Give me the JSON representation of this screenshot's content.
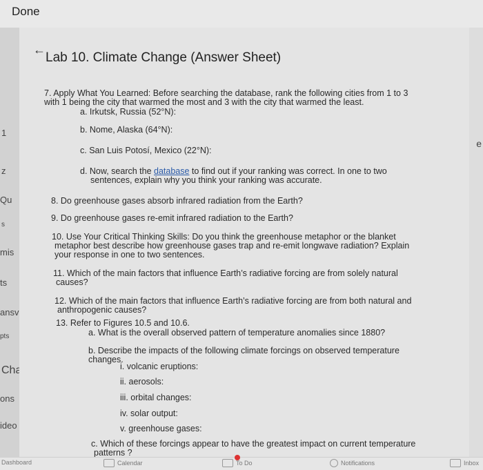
{
  "topbar": {
    "done_label": "Done"
  },
  "left_fragments": [
    "1",
    "z",
    "Qu",
    "s",
    "mis",
    "ts",
    "ansv",
    "pts",
    "Cha",
    "ons",
    "ideo",
    "Dashboard"
  ],
  "right_fragment": "e",
  "header": {
    "back_icon": "arrow-left-icon",
    "title": "Lab 10. Climate Change (Answer Sheet)"
  },
  "questions": {
    "q7": {
      "text_line1": "7. Apply What You Learned: Before searching the database, rank the following cities from 1 to 3",
      "text_line2": "with 1 being the city that warmed the most and 3 with the city that warmed the least.",
      "a": "a. Irkutsk, Russia (52°N):",
      "b": "b. Nome, Alaska (64°N):",
      "c": "c. San Luis Potosí, Mexico (22°N):",
      "d_line1_pre": "d. Now, search the ",
      "d_link": "database",
      "d_line1_post": " to find out if your ranking was correct. In one to two",
      "d_line2": "sentences, explain why you think your ranking was accurate."
    },
    "q8": "8. Do greenhouse gases absorb infrared radiation from the Earth?",
    "q9": "9. Do greenhouse gases re-emit infrared radiation to the Earth?",
    "q10": {
      "line1": "10. Use Your Critical Thinking Skills: Do you think the greenhouse metaphor or the blanket",
      "line2": "metaphor best describe how greenhouse gases trap and re-emit longwave radiation? Explain",
      "line3": "your response in one to two sentences."
    },
    "q11": {
      "line1": "11. Which of the main factors that influence Earth’s radiative forcing are from solely natural",
      "line2": "causes?"
    },
    "q12": {
      "line1": "12. Which of the main factors that influence Earth’s radiative forcing are from both natural and",
      "line2": "anthropogenic causes?"
    },
    "q13": {
      "line1": "13. Refer to Figures 10.5 and 10.6.",
      "a": "a. What is the overall observed pattern of temperature anomalies since 1880?",
      "b_line1": "b. Describe the impacts of the following climate forcings on observed temperature",
      "b_line2": "changes.",
      "i": "i. volcanic eruptions:",
      "ii": "ii. aerosols:",
      "iii": "iii. orbital changes:",
      "iv": "iv. solar output:",
      "v": "v. greenhouse gases:",
      "c_line1": "c. Which of these forcings appear to have the greatest impact on current temperature",
      "c_line2": "patterns ?"
    }
  },
  "bottom_nav": {
    "calendar": "Calendar",
    "todo": "To Do",
    "notifications": "Notifications",
    "inbox": "Inbox"
  }
}
